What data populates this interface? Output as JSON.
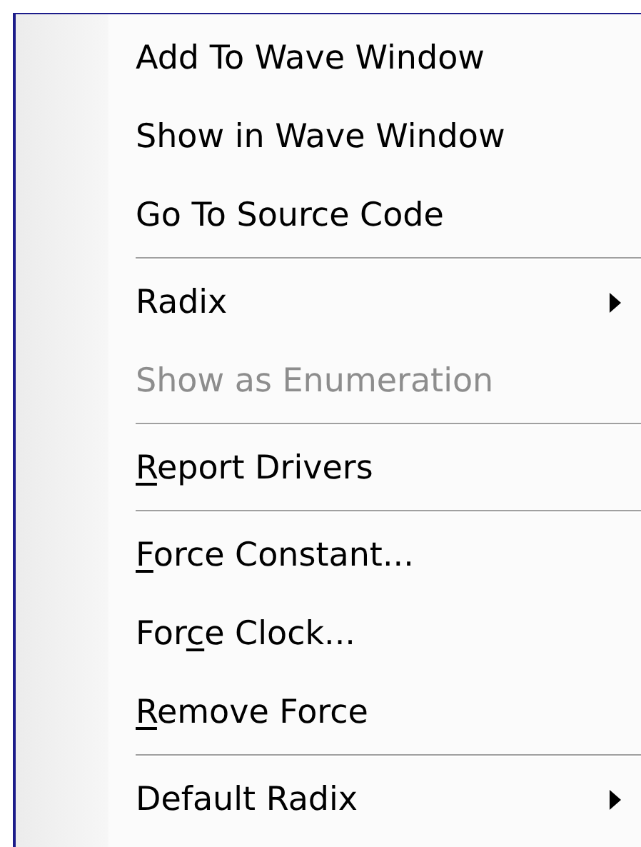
{
  "context_menu": {
    "items": [
      {
        "kind": "item",
        "label_parts": [
          {
            "text": "Add To Wave Window",
            "underlined": false
          }
        ],
        "disabled": false,
        "submenu": false
      },
      {
        "kind": "item",
        "label_parts": [
          {
            "text": "Show in Wave Window",
            "underlined": false
          }
        ],
        "disabled": false,
        "submenu": false
      },
      {
        "kind": "item",
        "label_parts": [
          {
            "text": "Go To Source Code",
            "underlined": false
          }
        ],
        "disabled": false,
        "submenu": false
      },
      {
        "kind": "separator"
      },
      {
        "kind": "item",
        "label_parts": [
          {
            "text": "Radix",
            "underlined": false
          }
        ],
        "disabled": false,
        "submenu": true
      },
      {
        "kind": "item",
        "label_parts": [
          {
            "text": "Show as Enumeration",
            "underlined": false
          }
        ],
        "disabled": true,
        "submenu": false
      },
      {
        "kind": "separator"
      },
      {
        "kind": "item",
        "label_parts": [
          {
            "text": "R",
            "underlined": true
          },
          {
            "text": "eport Drivers",
            "underlined": false
          }
        ],
        "disabled": false,
        "submenu": false
      },
      {
        "kind": "separator"
      },
      {
        "kind": "item",
        "label_parts": [
          {
            "text": "F",
            "underlined": true
          },
          {
            "text": "orce Constant...",
            "underlined": false
          }
        ],
        "disabled": false,
        "submenu": false
      },
      {
        "kind": "item",
        "label_parts": [
          {
            "text": "For",
            "underlined": false
          },
          {
            "text": "c",
            "underlined": true
          },
          {
            "text": "e Clock...",
            "underlined": false
          }
        ],
        "disabled": false,
        "submenu": false
      },
      {
        "kind": "item",
        "label_parts": [
          {
            "text": "R",
            "underlined": true
          },
          {
            "text": "emove Force",
            "underlined": false
          }
        ],
        "disabled": false,
        "submenu": false
      },
      {
        "kind": "separator"
      },
      {
        "kind": "item",
        "label_parts": [
          {
            "text": "Default Radix",
            "underlined": false
          }
        ],
        "disabled": false,
        "submenu": true
      }
    ]
  }
}
